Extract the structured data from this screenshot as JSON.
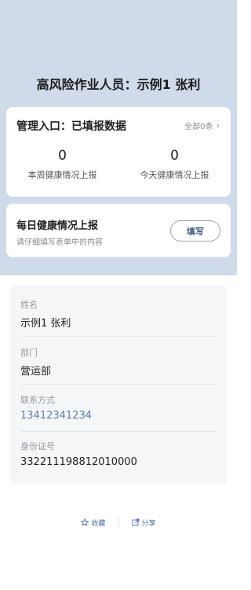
{
  "page_title": "高风险作业人员：示例1 张利",
  "management": {
    "title": "管理入口：已填报数据",
    "view_all": "全部0条",
    "stats": [
      {
        "value": "0",
        "label": "本周健康情况上报"
      },
      {
        "value": "0",
        "label": "今天健康情况上报"
      }
    ]
  },
  "daily_report": {
    "title": "每日健康情况上报",
    "subtitle": "请仔细填写表单中的内容",
    "button": "填写"
  },
  "profile": {
    "fields": [
      {
        "label": "姓名",
        "value": "示例1 张利"
      },
      {
        "label": "部门",
        "value": "营运部"
      },
      {
        "label": "联系方式",
        "value": "13412341234"
      },
      {
        "label": "身份证号",
        "value": "332211198812010000"
      }
    ]
  },
  "footer": {
    "favorite": "收藏",
    "share": "分享"
  },
  "colors": {
    "hero_bg": "#cfdaea",
    "accent": "#4a6fb0",
    "phone_link": "#5a7fa8"
  },
  "icons": {
    "chevron": "chevron-right-icon",
    "favorite": "star-icon",
    "share": "share-icon"
  }
}
